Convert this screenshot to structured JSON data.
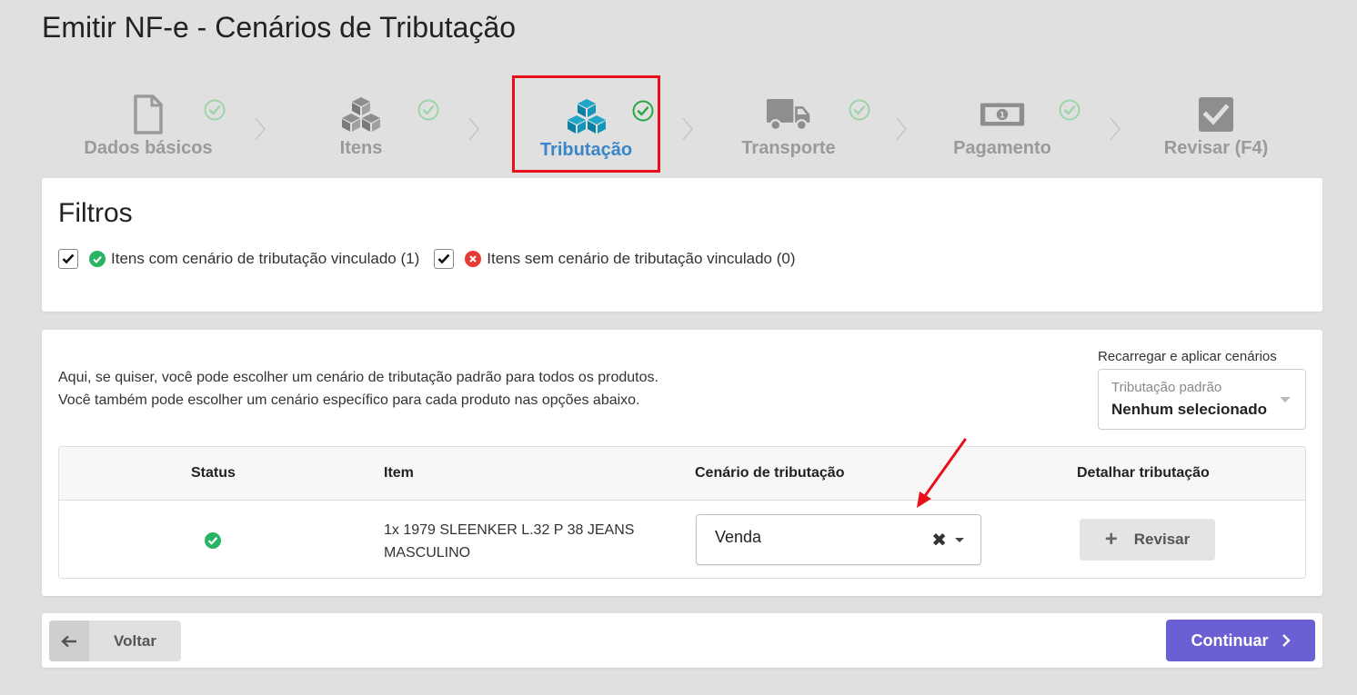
{
  "page": {
    "title": "Emitir NF-e - Cenários de Tributação"
  },
  "stepper": {
    "steps": [
      {
        "label": "Dados básicos",
        "icon": "document-icon",
        "completed": true
      },
      {
        "label": "Itens",
        "icon": "cubes-icon",
        "completed": true
      },
      {
        "label": "Tributação",
        "icon": "cubes-icon",
        "completed": true,
        "active": true
      },
      {
        "label": "Transporte",
        "icon": "truck-icon",
        "completed": true
      },
      {
        "label": "Pagamento",
        "icon": "money-icon",
        "completed": true
      },
      {
        "label": "Revisar (F4)",
        "icon": "checkbox-icon",
        "completed": false
      }
    ]
  },
  "filters": {
    "title": "Filtros",
    "with_scenario": "Itens com cenário de tributação vinculado (1)",
    "without_scenario": "Itens sem cenário de tributação vinculado (0)"
  },
  "scenarios": {
    "intro_line1": "Aqui, se quiser, você pode escolher um cenário de tributação padrão para todos os produtos.",
    "intro_line2": "Você também pode escolher um cenário específico para cada produto nas opções abaixo.",
    "reload_label": "Recarregar e aplicar cenários",
    "default_select": {
      "label": "Tributação padrão",
      "value": "Nenhum selecionado"
    },
    "table": {
      "headers": {
        "status": "Status",
        "item": "Item",
        "scenario": "Cenário de tributação",
        "detail": "Detalhar tributação"
      },
      "rows": [
        {
          "item": "1x 1979 SLEENKER L.32 P 38 JEANS MASCULINO",
          "scenario": "Venda",
          "action": "Revisar"
        }
      ]
    }
  },
  "footer": {
    "back_label": "Voltar",
    "continue_label": "Continuar"
  },
  "colors": {
    "accent": "#6a5fd3",
    "active_step": "#3a86c8",
    "success": "#28b463",
    "error": "#e53935",
    "highlight": "#e8101b"
  }
}
